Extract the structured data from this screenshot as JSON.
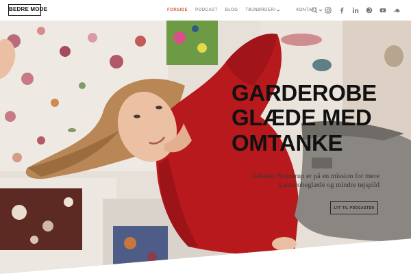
{
  "brand": {
    "logo_text": "BEDRE MODE"
  },
  "nav": {
    "items": [
      {
        "label": "FORSIDE",
        "active": true,
        "has_dropdown": false
      },
      {
        "label": "PODCAST",
        "active": false,
        "has_dropdown": false
      },
      {
        "label": "BLOG",
        "active": false,
        "has_dropdown": false
      },
      {
        "label": "TØJNØRDERI",
        "active": false,
        "has_dropdown": true
      }
    ],
    "contact": {
      "label": "KONTAKT",
      "has_dropdown": true
    }
  },
  "header_icons": [
    "search-icon",
    "instagram-icon",
    "facebook-icon",
    "linkedin-icon",
    "pinterest-icon",
    "youtube-icon",
    "soundcloud-icon"
  ],
  "hero": {
    "title_lines": [
      "GARDEROBE",
      "GLÆDE MED",
      "OMTANKE"
    ],
    "subtitle": "Johanne Stenstrup er på en mission for mere garderobeglæde og mindre tøjspild",
    "button_label": "LYT TIL PODCASTEN"
  },
  "colors": {
    "accent": "#c9623f",
    "text": "#111111",
    "muted": "#666666"
  }
}
